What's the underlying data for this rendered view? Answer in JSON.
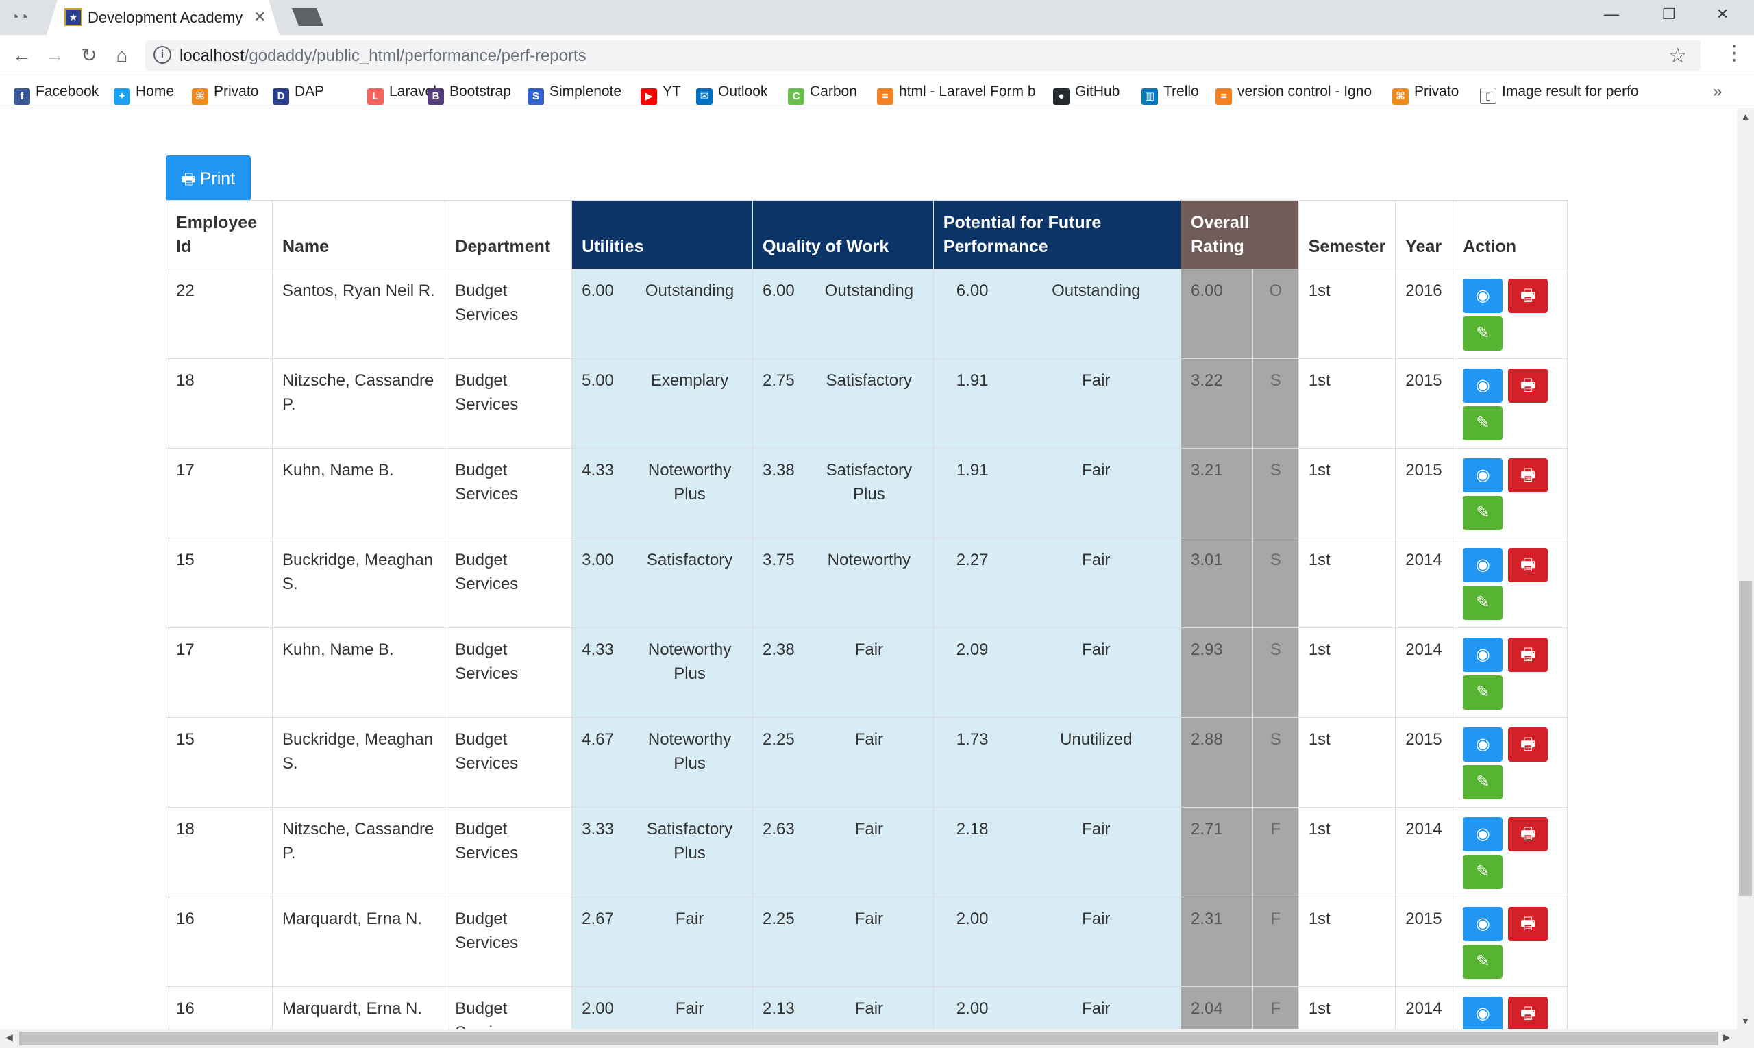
{
  "browser": {
    "tab_title": "Development Academy o",
    "url_host": "localhost",
    "url_path": "/godaddy/public_html/performance/perf-reports",
    "bookmarks": [
      {
        "label": "Facebook",
        "icon": "facebook-icon",
        "color": "#3b5998",
        "glyph": "f"
      },
      {
        "label": "Home",
        "icon": "twitter-icon",
        "color": "#1da1f2",
        "glyph": "✦"
      },
      {
        "label": "Privato",
        "icon": "privato-icon",
        "color": "#f38b1c",
        "glyph": "⌘"
      },
      {
        "label": "DAP",
        "icon": "dap-icon",
        "color": "#2b3f8c",
        "glyph": "D"
      },
      {
        "label": "Laravel",
        "icon": "laravel-icon",
        "color": "#f4645f",
        "glyph": "L"
      },
      {
        "label": "Bootstrap",
        "icon": "bootstrap-icon",
        "color": "#563d7c",
        "glyph": "B"
      },
      {
        "label": "Simplenote",
        "icon": "simplenote-icon",
        "color": "#3361cc",
        "glyph": "S"
      },
      {
        "label": "YT",
        "icon": "youtube-icon",
        "color": "#ff0000",
        "glyph": "▶"
      },
      {
        "label": "Outlook",
        "icon": "outlook-icon",
        "color": "#0072c6",
        "glyph": "✉"
      },
      {
        "label": "Carbon",
        "icon": "carbon-icon",
        "color": "#6bbf4e",
        "glyph": "C"
      },
      {
        "label": "html - Laravel Form b",
        "icon": "stackoverflow-icon",
        "color": "#f48024",
        "glyph": "≡"
      },
      {
        "label": "GitHub",
        "icon": "github-icon",
        "color": "#24292e",
        "glyph": "●"
      },
      {
        "label": "Trello",
        "icon": "trello-icon",
        "color": "#0079bf",
        "glyph": "▥"
      },
      {
        "label": "version control - Igno",
        "icon": "stackoverflow-icon",
        "color": "#f48024",
        "glyph": "≡"
      },
      {
        "label": "Privato",
        "icon": "privato-icon",
        "color": "#f38b1c",
        "glyph": "⌘"
      },
      {
        "label": "Image result for perfo",
        "icon": "page-icon",
        "color": "#ffffff",
        "glyph": "▯"
      }
    ]
  },
  "page": {
    "print_label": "Print",
    "headers": {
      "employee_id": "Employee Id",
      "name": "Name",
      "department": "Department",
      "utilities": "Utilities",
      "quality": "Quality of Work",
      "potential": "Potential for Future Performance",
      "overall": "Overall Rating",
      "semester": "Semester",
      "year": "Year",
      "action": "Action"
    },
    "rows": [
      {
        "id": "22",
        "name": "Santos, Ryan Neil R.",
        "dept": "Budget Services",
        "u_score": "6.00",
        "u_rating": "Outstanding",
        "q_score": "6.00",
        "q_rating": "Outstanding",
        "p_score": "6.00",
        "p_rating": "Outstanding",
        "o_score": "6.00",
        "o_letter": "O",
        "semester": "1st",
        "year": "2016"
      },
      {
        "id": "18",
        "name": "Nitzsche, Cassandre P.",
        "dept": "Budget Services",
        "u_score": "5.00",
        "u_rating": "Exemplary",
        "q_score": "2.75",
        "q_rating": "Satisfactory",
        "p_score": "1.91",
        "p_rating": "Fair",
        "o_score": "3.22",
        "o_letter": "S",
        "semester": "1st",
        "year": "2015"
      },
      {
        "id": "17",
        "name": "Kuhn, Name B.",
        "dept": "Budget Services",
        "u_score": "4.33",
        "u_rating": "Noteworthy Plus",
        "q_score": "3.38",
        "q_rating": "Satisfactory Plus",
        "p_score": "1.91",
        "p_rating": "Fair",
        "o_score": "3.21",
        "o_letter": "S",
        "semester": "1st",
        "year": "2015"
      },
      {
        "id": "15",
        "name": "Buckridge, Meaghan S.",
        "dept": "Budget Services",
        "u_score": "3.00",
        "u_rating": "Satisfactory",
        "q_score": "3.75",
        "q_rating": "Noteworthy",
        "p_score": "2.27",
        "p_rating": "Fair",
        "o_score": "3.01",
        "o_letter": "S",
        "semester": "1st",
        "year": "2014"
      },
      {
        "id": "17",
        "name": "Kuhn, Name B.",
        "dept": "Budget Services",
        "u_score": "4.33",
        "u_rating": "Noteworthy Plus",
        "q_score": "2.38",
        "q_rating": "Fair",
        "p_score": "2.09",
        "p_rating": "Fair",
        "o_score": "2.93",
        "o_letter": "S",
        "semester": "1st",
        "year": "2014"
      },
      {
        "id": "15",
        "name": "Buckridge, Meaghan S.",
        "dept": "Budget Services",
        "u_score": "4.67",
        "u_rating": "Noteworthy Plus",
        "q_score": "2.25",
        "q_rating": "Fair",
        "p_score": "1.73",
        "p_rating": "Unutilized",
        "o_score": "2.88",
        "o_letter": "S",
        "semester": "1st",
        "year": "2015"
      },
      {
        "id": "18",
        "name": "Nitzsche, Cassandre P.",
        "dept": "Budget Services",
        "u_score": "3.33",
        "u_rating": "Satisfactory Plus",
        "q_score": "2.63",
        "q_rating": "Fair",
        "p_score": "2.18",
        "p_rating": "Fair",
        "o_score": "2.71",
        "o_letter": "F",
        "semester": "1st",
        "year": "2014"
      },
      {
        "id": "16",
        "name": "Marquardt, Erna N.",
        "dept": "Budget Services",
        "u_score": "2.67",
        "u_rating": "Fair",
        "q_score": "2.25",
        "q_rating": "Fair",
        "p_score": "2.00",
        "p_rating": "Fair",
        "o_score": "2.31",
        "o_letter": "F",
        "semester": "1st",
        "year": "2015"
      },
      {
        "id": "16",
        "name": "Marquardt, Erna N.",
        "dept": "Budget Services",
        "u_score": "2.00",
        "u_rating": "Fair",
        "q_score": "2.13",
        "q_rating": "Fair",
        "p_score": "2.00",
        "p_rating": "Fair",
        "o_score": "2.04",
        "o_letter": "F",
        "semester": "1st",
        "year": "2014"
      }
    ]
  }
}
